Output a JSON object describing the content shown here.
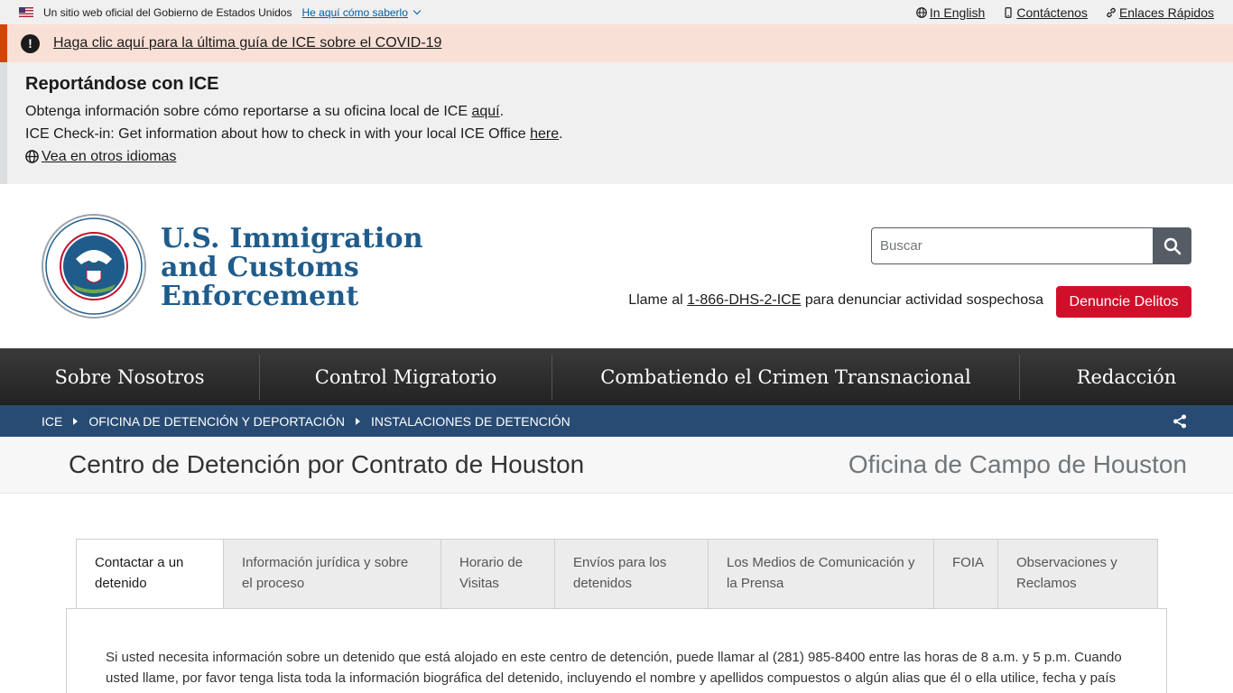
{
  "gov_banner": {
    "text": "Un sitio web oficial del Gobierno de Estados Unidos",
    "howto": "He aquí cómo saberlo"
  },
  "util_links": {
    "english": "In English",
    "contact": "Contáctenos",
    "quick": "Enlaces Rápidos"
  },
  "alert": {
    "link": "Haga clic aquí para la última guía de ICE sobre el COVID-19"
  },
  "reporting": {
    "title": "Reportándose con ICE",
    "line1_prefix": "Obtenga información sobre cómo reportarse a su oficina local de ICE ",
    "line1_link": "aquí",
    "line1_suffix": ".",
    "line2_prefix": "ICE Check-in: Get information about how to check in with your local ICE Office ",
    "line2_link": "here",
    "line2_suffix": ".",
    "languages": " Vea en otros idiomas"
  },
  "header": {
    "agency_line1": "U.S. Immigration",
    "agency_line2": "and Customs",
    "agency_line3": "Enforcement",
    "search_placeholder": "Buscar",
    "report_prefix": "Llame al ",
    "report_phone": "1-866-DHS-2-ICE",
    "report_suffix": " para denunciar actividad sospechosa",
    "report_button": "Denuncie Delitos"
  },
  "nav": {
    "items": [
      "Sobre Nosotros",
      "Control Migratorio",
      "Combatiendo el Crimen Transnacional",
      "Redacción"
    ]
  },
  "breadcrumb": {
    "items": [
      "ICE",
      "OFICINA DE DETENCIÓN Y DEPORTACIÓN",
      "INSTALACIONES DE DETENCIÓN"
    ]
  },
  "page": {
    "title": "Centro de Detención por Contrato de Houston",
    "field_office": "Oficina de Campo de Houston"
  },
  "tabs": [
    "Contactar a un detenido",
    "Información jurídica y sobre el proceso",
    "Horario de Visitas",
    "Envíos para los detenidos",
    "Los Medios de Comunicación y la Prensa",
    "FOIA",
    "Observaciones y Reclamos"
  ],
  "panel": {
    "text": "Si usted necesita información sobre un detenido que está alojado en este centro de detención, puede llamar al (281) 985-8400 entre las horas de 8 a.m. y 5 p.m. Cuando usted llame, por favor tenga lista toda la información biográfica del detenido, incluyendo el nombre y apellidos compuestos o algún alias que él o ella utilice, fecha y país de nacimiento."
  },
  "colors": {
    "alert_bg": "#f9e0d6",
    "alert_border": "#d54309",
    "brand_blue": "#1f5c8b",
    "breadcrumb_bg": "#284b73",
    "report_red": "#d0102a"
  }
}
